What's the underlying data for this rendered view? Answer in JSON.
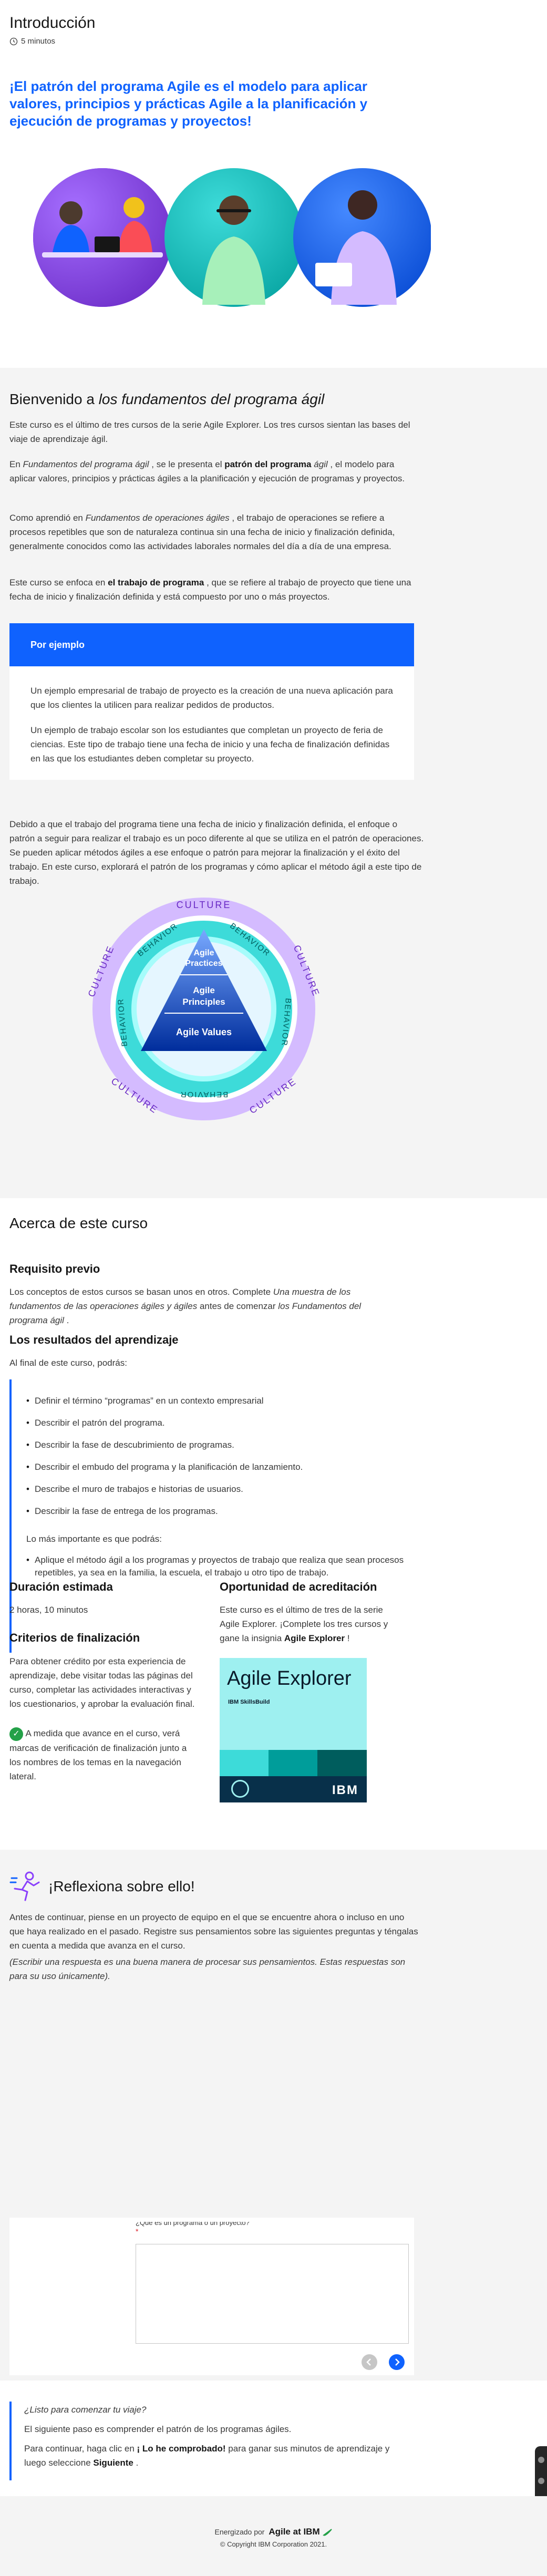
{
  "header": {
    "title": "Introducción",
    "duration": "5 minutos",
    "tagline": "¡El patrón del programa Agile es el modelo para aplicar valores, principios y prácticas Agile a la planificación y ejecución de programas y proyectos!"
  },
  "welcome": {
    "title_prefix": "Bienvenido a ",
    "title_em": "los fundamentos del programa ágil",
    "p1": "Este curso es el último de tres cursos de la serie Agile Explorer. Los tres cursos sientan las bases del viaje de aprendizaje ágil.",
    "p2_a": "En ",
    "p2_em": "Fundamentos del programa ágil",
    "p2_b": " , se le presenta el ",
    "p2_bold": "patrón del programa",
    "p2_em2": " ágil",
    "p2_c": " , el modelo para aplicar valores, principios y prácticas ágiles a la planificación y ejecución de programas y proyectos.",
    "p3_a": "Como aprendió en ",
    "p3_em": "Fundamentos de operaciones ágiles",
    "p3_b": " , el trabajo de operaciones se refiere a procesos repetibles que son de naturaleza continua sin una fecha de inicio y finalización definida, generalmente conocidos como las actividades laborales normales del día a día de una empresa.",
    "p4_a": "Este curso se enfoca en ",
    "p4_bold": "el trabajo de programa",
    "p4_b": " , que se refiere al trabajo de proyecto que tiene una fecha de inicio y finalización definida y está compuesto por uno o más proyectos."
  },
  "example_box": {
    "title": "Por ejemplo",
    "p1": "Un ejemplo empresarial de trabajo de proyecto es la creación de una nueva aplicación para que los clientes la utilicen para realizar pedidos de productos.",
    "p2": "Un ejemplo de trabajo escolar son los estudiantes que completan un proyecto de feria de ciencias. Este tipo de trabajo tiene una fecha de inicio y una fecha de finalización definidas en las que los estudiantes deben completar su proyecto."
  },
  "after_box": {
    "p1": "Debido a que el trabajo del programa tiene una fecha de inicio y finalización definida, el enfoque o patrón a seguir para realizar el trabajo es un poco diferente al que se utiliza en el patrón de operaciones. Se pueden aplicar métodos ágiles a ese enfoque o patrón para mejorar la finalización y el éxito del trabajo. En este curso, explorará el patrón de los programas y cómo aplicar el método ágil a este tipo de trabajo."
  },
  "diagram": {
    "ring_top": "CULTURE",
    "ring_left": "CULTURE",
    "ring_right": "CULTURE",
    "ring_bottom_left": "CULTURE",
    "ring_bottom_right": "CULTURE",
    "behavior_tl": "BEHAVIOR",
    "behavior_tr": "BEHAVIOR",
    "behavior_l": "BEHAVIOR",
    "behavior_r": "BEHAVIOR",
    "behavior_b": "BEHAVIOR",
    "tier1": [
      "Agile",
      "Practices"
    ],
    "tier2": [
      "Agile",
      "Principles"
    ],
    "tier3": "Agile Values"
  },
  "about": {
    "title": "Acerca de este curso",
    "prereq_title": "Requisito previo",
    "prereq_a": "Los conceptos de estos cursos se basan unos en otros. Complete ",
    "prereq_em1": "Una muestra de los fundamentos de las operaciones ágiles y ágiles",
    "prereq_b": " antes de comenzar ",
    "prereq_em2": "los Fundamentos del programa ágil",
    "prereq_c": " .",
    "outcomes_title": "Los resultados del aprendizaje",
    "outcomes_intro": "Al final de este curso, podrás:",
    "outcomes": [
      "Definir el término “programas” en un contexto empresarial",
      "Describir el patrón del programa.",
      "Describir la fase de descubrimiento de programas.",
      "Describir el embudo del programa y la planificación de lanzamiento.",
      "Describe el muro de trabajos e historias de usuarios.",
      "Describir la fase de entrega de los programas."
    ],
    "important_intro": "Lo más importante es que podrás:",
    "important": [
      "Aplique el método ágil a los programas y proyectos de trabajo que realiza que sean procesos repetibles, ya sea en la familia, la escuela, el trabajo u otro tipo de trabajo."
    ],
    "duration_title": "Duración estimada",
    "duration_value": "2 horas, 10 minutos",
    "completion_title": "Criterios de finalización",
    "completion_text": "Para obtener crédito por esta experiencia de aprendizaje, debe visitar todas las páginas del curso, completar las actividades interactivas y los cuestionarios, y aprobar la evaluación final.",
    "progress_text": "A medida que avance en el curso, verá marcas de verificación de finalización junto a los nombres de los temas en la navegación lateral.",
    "accred_title": "Oportunidad de acreditación",
    "accred_a": "Este curso es el último de tres de la serie Agile Explorer. ¡Complete los tres cursos y gane la insignia ",
    "accred_bold": "Agile Explorer",
    "accred_b": " !",
    "badge_title": "Agile Explorer",
    "badge_brand": "IBM SkillsBuild",
    "badge_logo": "IBM"
  },
  "reflect": {
    "title": "¡Reflexiona sobre ello!",
    "p1": "Antes de continuar, piense en un proyecto de equipo en el que se encuentre ahora o incluso en uno que haya realizado en el pasado. Registre sus pensamientos sobre las siguientes preguntas y téngalas en cuenta a medida que avanza en el curso.",
    "p2": "(Escribir una respuesta es una buena manera de procesar sus pensamientos. Estas respuestas son para su uso únicamente).",
    "card_question": "¿Qué es un programa o un proyecto?",
    "card_required": "*"
  },
  "ready": {
    "q": "¿Listo para comenzar tu viaje?",
    "p1": "El siguiente paso es comprender el patrón de los programas ágiles.",
    "p2_a": "Para continuar, haga clic en ",
    "p2_bold": "¡ Lo he comprobado!",
    "p2_b": " para ganar sus minutos de aprendizaje y luego seleccione ",
    "p2_bold2": "Siguiente",
    "p2_c": " ."
  },
  "footer": {
    "powered": "Energizado por",
    "brand": "Agile at IBM",
    "copyright": "© Copyright IBM Corporation 2021."
  },
  "colors": {
    "accent_blue": "#0f62fe",
    "link_blue": "#0043ce",
    "box_blue": "#0f62fe",
    "section_gray": "#f4f4f4",
    "teal": "#3ddbd9",
    "purple": "#8a3ffc",
    "green": "#24a148"
  }
}
